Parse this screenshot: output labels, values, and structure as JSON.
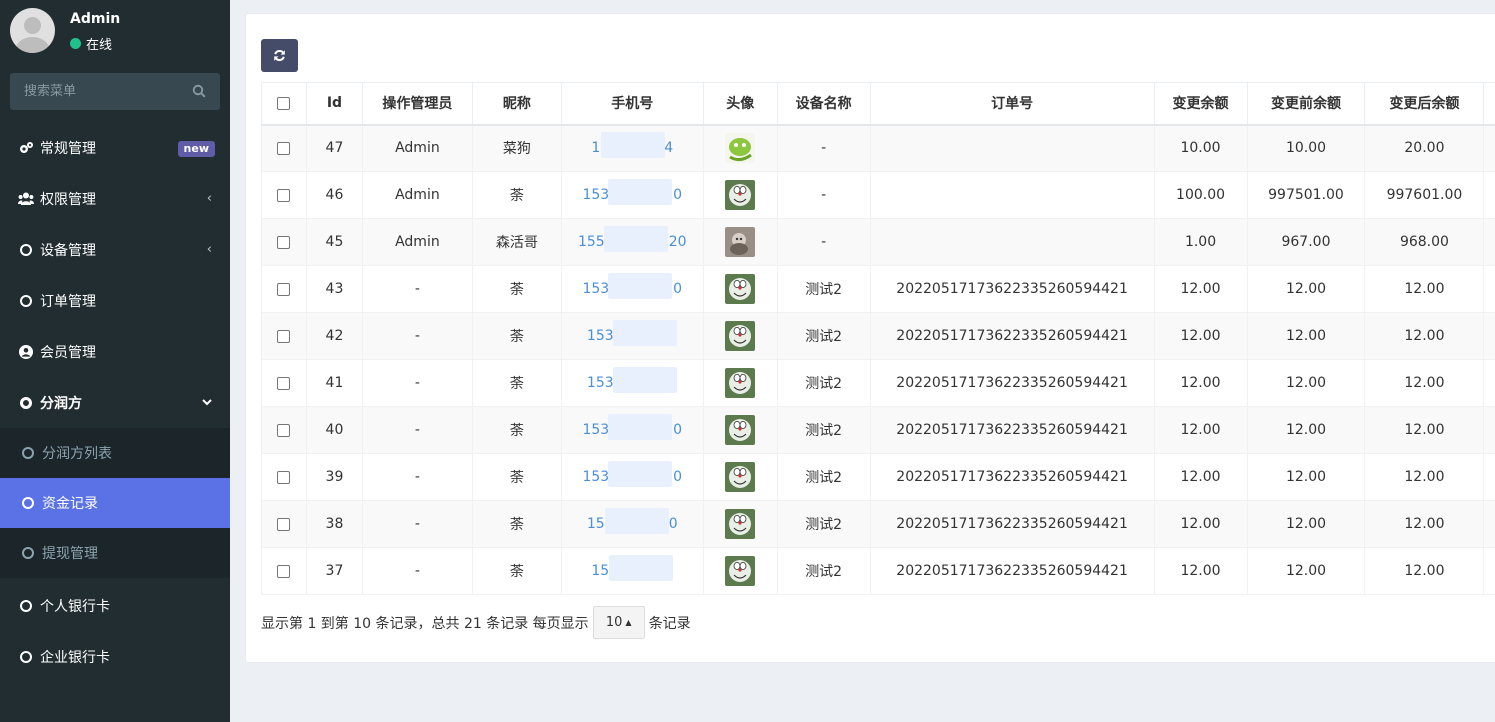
{
  "user": {
    "name": "Admin",
    "status": "在线"
  },
  "search": {
    "placeholder": "搜索菜单"
  },
  "menu": [
    {
      "label": "常规管理",
      "badge": "new",
      "icon": "cogs-icon"
    },
    {
      "label": "权限管理",
      "icon": "users-icon"
    },
    {
      "label": "设备管理",
      "icon": "circle-icon"
    },
    {
      "label": "订单管理",
      "icon": "circle-icon"
    },
    {
      "label": "会员管理",
      "icon": "user-circle-icon"
    },
    {
      "label": "分润方",
      "icon": "circle-icon"
    }
  ],
  "submenu": [
    {
      "label": "分润方列表"
    },
    {
      "label": "资金记录"
    },
    {
      "label": "提现管理"
    }
  ],
  "menu_after": [
    {
      "label": "个人银行卡",
      "icon": "circle-icon"
    },
    {
      "label": "企业银行卡",
      "icon": "circle-icon"
    }
  ],
  "table": {
    "headers": [
      "Id",
      "操作管理员",
      "昵称",
      "手机号",
      "头像",
      "设备名称",
      "订单号",
      "变更余额",
      "变更前余额",
      "变更后余额"
    ],
    "rows": [
      {
        "id": "47",
        "admin": "Admin",
        "nick": "菜狗",
        "phone_start": "1",
        "phone_end": "4",
        "device": "-",
        "order": "",
        "change": "10.00",
        "before": "10.00",
        "after": "20.00",
        "avatar": "avatar-green-icon"
      },
      {
        "id": "46",
        "admin": "Admin",
        "nick": "荼",
        "phone_start": "153",
        "phone_end": "0",
        "device": "-",
        "order": "",
        "change": "100.00",
        "before": "997501.00",
        "after": "997601.00",
        "avatar": "avatar-doraemon-icon"
      },
      {
        "id": "45",
        "admin": "Admin",
        "nick": "森活哥",
        "phone_start": "155",
        "phone_end": "20",
        "device": "-",
        "order": "",
        "change": "1.00",
        "before": "967.00",
        "after": "968.00",
        "avatar": "avatar-monkey-icon"
      },
      {
        "id": "43",
        "admin": "-",
        "nick": "荼",
        "phone_start": "153",
        "phone_end": "0",
        "device": "测试2",
        "order": "20220517173622335260594421",
        "change": "12.00",
        "before": "12.00",
        "after": "12.00",
        "avatar": "avatar-doraemon-icon"
      },
      {
        "id": "42",
        "admin": "-",
        "nick": "荼",
        "phone_start": "153",
        "phone_end": "",
        "device": "测试2",
        "order": "20220517173622335260594421",
        "change": "12.00",
        "before": "12.00",
        "after": "12.00",
        "avatar": "avatar-doraemon-icon"
      },
      {
        "id": "41",
        "admin": "-",
        "nick": "荼",
        "phone_start": "153",
        "phone_end": "",
        "device": "测试2",
        "order": "20220517173622335260594421",
        "change": "12.00",
        "before": "12.00",
        "after": "12.00",
        "avatar": "avatar-doraemon-icon"
      },
      {
        "id": "40",
        "admin": "-",
        "nick": "荼",
        "phone_start": "153",
        "phone_end": "0",
        "device": "测试2",
        "order": "20220517173622335260594421",
        "change": "12.00",
        "before": "12.00",
        "after": "12.00",
        "avatar": "avatar-doraemon-icon"
      },
      {
        "id": "39",
        "admin": "-",
        "nick": "荼",
        "phone_start": "153",
        "phone_end": "0",
        "device": "测试2",
        "order": "20220517173622335260594421",
        "change": "12.00",
        "before": "12.00",
        "after": "12.00",
        "avatar": "avatar-doraemon-icon"
      },
      {
        "id": "38",
        "admin": "-",
        "nick": "荼",
        "phone_start": "15",
        "phone_end": "0",
        "device": "测试2",
        "order": "20220517173622335260594421",
        "change": "12.00",
        "before": "12.00",
        "after": "12.00",
        "avatar": "avatar-doraemon-icon"
      },
      {
        "id": "37",
        "admin": "-",
        "nick": "荼",
        "phone_start": "15",
        "phone_end": "",
        "device": "测试2",
        "order": "20220517173622335260594421",
        "change": "12.00",
        "before": "12.00",
        "after": "12.00",
        "avatar": "avatar-doraemon-icon"
      }
    ]
  },
  "pager": {
    "summary": "显示第 1 到第 10 条记录，总共 21 条记录 每页显示",
    "page_size": "10",
    "suffix": "条记录"
  },
  "colors": {
    "sidebar": "#222d32",
    "active": "#5a72e6",
    "link": "#4a8fd6",
    "badge": "#605ca8",
    "button": "#444c69"
  }
}
